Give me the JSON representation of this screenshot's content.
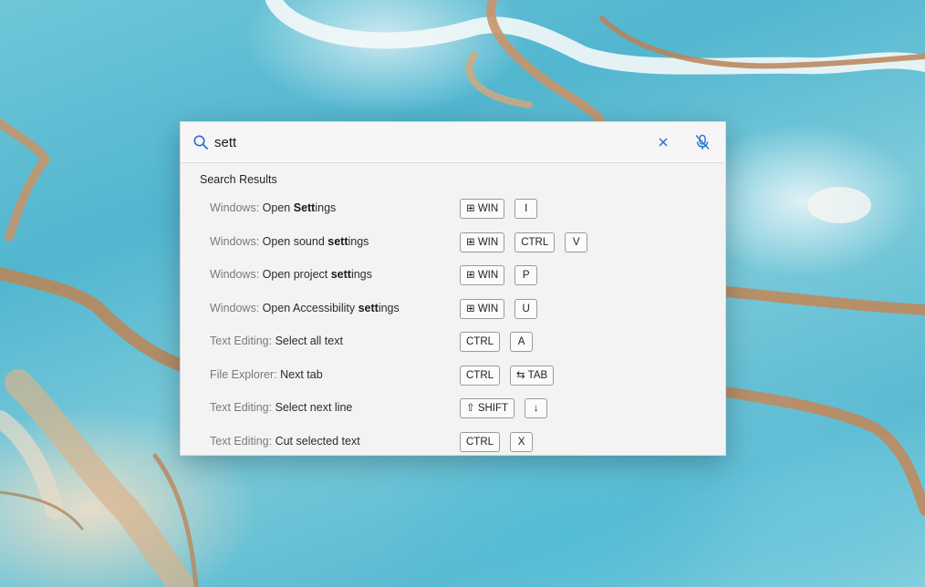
{
  "search": {
    "value": "sett",
    "placeholder": ""
  },
  "results_heading": "Search Results",
  "results": [
    {
      "category": "Windows:",
      "pre": "Open ",
      "match": "Sett",
      "post": "ings",
      "keys": [
        "⊞ WIN",
        "I"
      ]
    },
    {
      "category": "Windows:",
      "pre": "Open sound ",
      "match": "sett",
      "post": "ings",
      "keys": [
        "⊞ WIN",
        "CTRL",
        "V"
      ]
    },
    {
      "category": "Windows:",
      "pre": "Open project ",
      "match": "sett",
      "post": "ings",
      "keys": [
        "⊞ WIN",
        "P"
      ]
    },
    {
      "category": "Windows:",
      "pre": "Open Accessibility ",
      "match": "sett",
      "post": "ings",
      "keys": [
        "⊞ WIN",
        "U"
      ]
    },
    {
      "category": "Text Editing:",
      "pre": "Select all text",
      "match": "",
      "post": "",
      "keys": [
        "CTRL",
        "A"
      ]
    },
    {
      "category": "File Explorer:",
      "pre": "Next tab",
      "match": "",
      "post": "",
      "keys": [
        "CTRL",
        "⇆ TAB"
      ]
    },
    {
      "category": "Text Editing:",
      "pre": "Select next line",
      "match": "",
      "post": "",
      "keys": [
        "⇧ SHIFT",
        "↓"
      ]
    },
    {
      "category": "Text Editing:",
      "pre": "Cut selected text",
      "match": "",
      "post": "",
      "keys": [
        "CTRL",
        "X"
      ]
    }
  ],
  "icons": {
    "search": "search-icon",
    "clear": "close-icon",
    "mic": "microphone-off-icon"
  },
  "colors": {
    "accent": "#2b6fd6",
    "panel": "#f3f3f3"
  }
}
